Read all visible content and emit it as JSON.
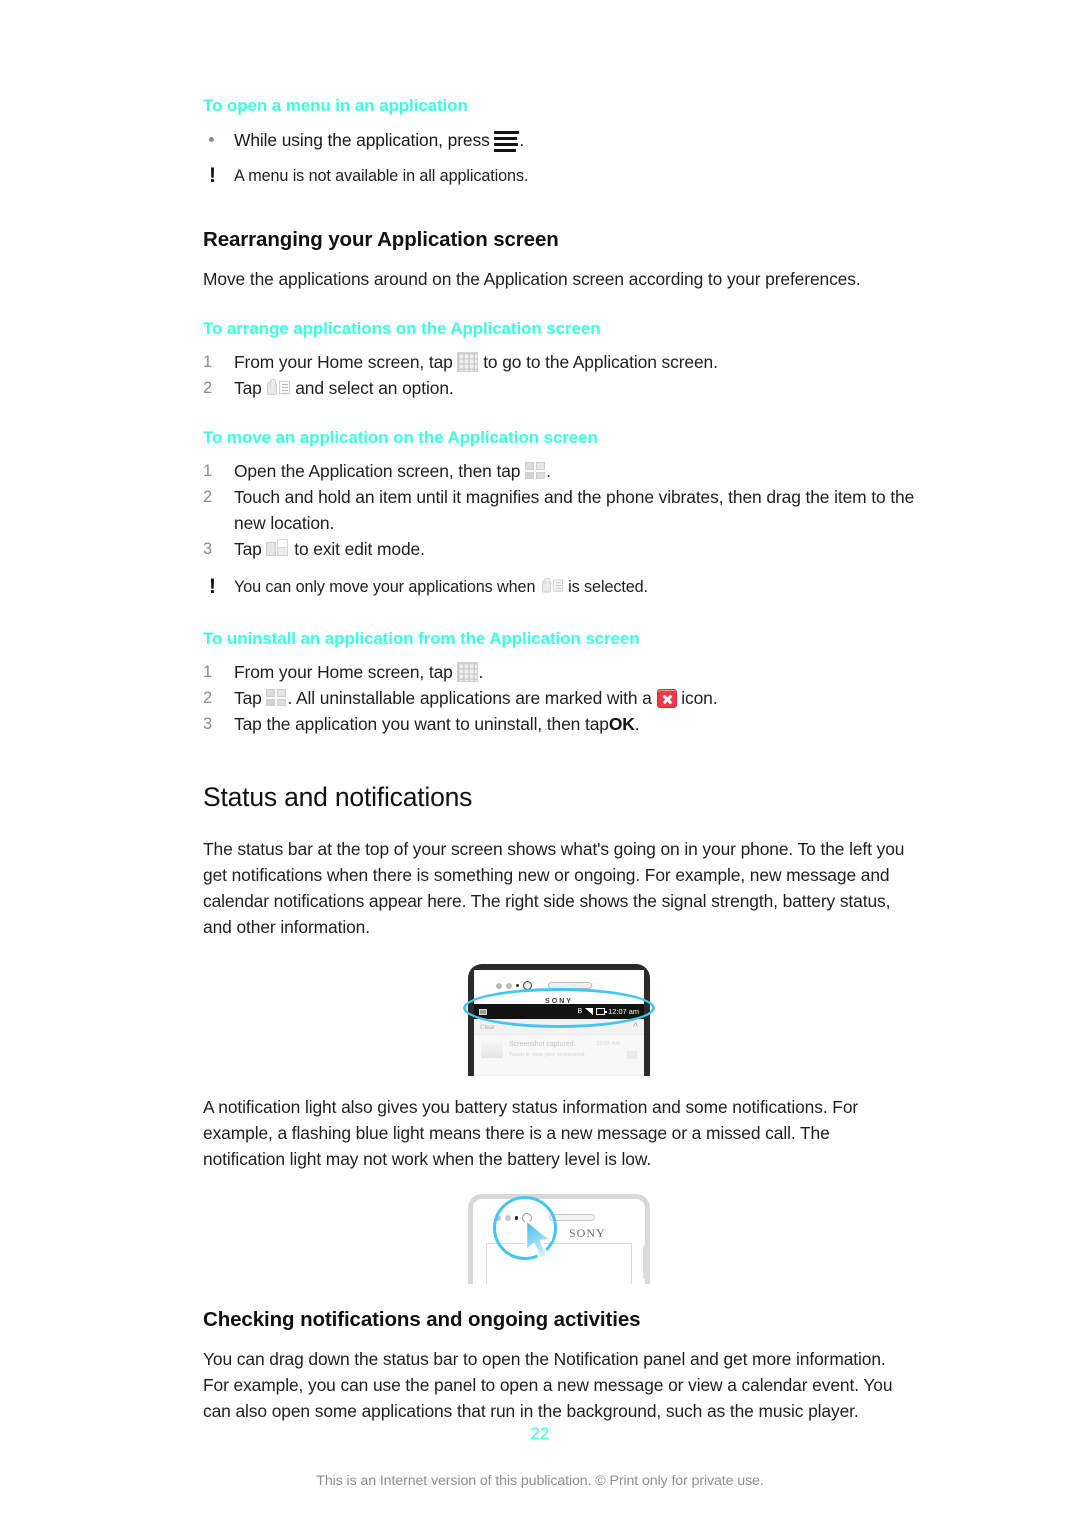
{
  "theme": {
    "accent_cyan": "#3DFFDE",
    "highlight_blue": "#45C6F0",
    "uninstall_badge_red": "#EE3A48",
    "step_number_grey": "#8B8B8B",
    "footer_grey": "#8E8E8E"
  },
  "sections": {
    "open_menu": {
      "heading": "To open a menu in an application",
      "bullet_before": "While using the application, press",
      "bullet_after": ".",
      "note": "A menu is not available in all applications."
    },
    "rearranging": {
      "heading": "Rearranging your Application screen",
      "intro": "Move the applications around on the Application screen according to your preferences.",
      "arrange": {
        "heading": "To arrange applications on the Application screen",
        "step1_before": "From your Home screen, tap",
        "step1_after": "to go to the Application screen.",
        "step1_num": "1",
        "step2_before": "Tap",
        "step2_after": "and select an option.",
        "step2_num": "2"
      },
      "move": {
        "heading": "To move an application on the Application screen",
        "step1_num": "1",
        "step1_before": "Open the Application screen, then tap",
        "step1_after": ".",
        "step2_num": "2",
        "step2_text": "Touch and hold an item until it magnifies and the phone vibrates, then drag the item to the new location.",
        "step3_num": "3",
        "step3_before": "Tap",
        "step3_after": "to exit edit mode.",
        "note_before": "You can only move your applications when",
        "note_after": "is selected."
      },
      "uninstall": {
        "heading": "To uninstall an application from the Application screen",
        "step1_num": "1",
        "step1_before": "From your Home screen, tap",
        "step1_after": ".",
        "step2_num": "2",
        "step2_before": "Tap",
        "step2_mid": ". All uninstallable applications are marked with a",
        "step2_after": "icon.",
        "step3_num": "3",
        "step3_before": "Tap the application you want to uninstall, then tap",
        "step3_bold": "OK",
        "step3_after": "."
      }
    },
    "status_notifications": {
      "heading": "Status and notifications",
      "paragraph1": "The status bar at the top of your screen shows what's going on in your phone. To the left you get notifications when there is something new or ongoing. For example, new message and calendar notifications appear here. The right side shows the signal strength, battery status, and other information.",
      "paragraph2": "A notification light also gives you battery status information and some notifications. For example, a flashing blue light means there is a new message or a missed call. The notification light may not work when the battery level is low."
    },
    "checking": {
      "heading": "Checking notifications and ongoing activities",
      "paragraph": "You can drag down the status bar to open the Notification panel and get more information. For example, you can use the panel to open a new message or view a calendar event. You can also open some applications that run in the background, such as the music player."
    }
  },
  "figures": {
    "status_bar_phone": {
      "brand": "SONY",
      "status_clock": "12:07 am",
      "status_bluetooth": "B",
      "notification_header": "Clear",
      "notification_title": "Screenshot captured.",
      "notification_subtitle": "Touch to view your screenshot.",
      "notification_time": "12:06 AM",
      "highlight_shape": "ellipse-status-bar"
    },
    "notification_light_phone": {
      "brand": "SONY",
      "highlight_shape": "circle-notification-light",
      "pointer": "arrow-cursor"
    }
  },
  "footer": {
    "page_number": "22",
    "note": "This is an Internet version of this publication. © Print only for private use."
  },
  "icons": {
    "menu_key": "menu-icon",
    "app_grid": "app-grid-icon",
    "arrange_hand": "arrange-hand-icon",
    "quad_grid": "quad-grid-icon",
    "exit_edit": "exit-edit-icon",
    "uninstall_badge": "uninstall-x-icon"
  }
}
